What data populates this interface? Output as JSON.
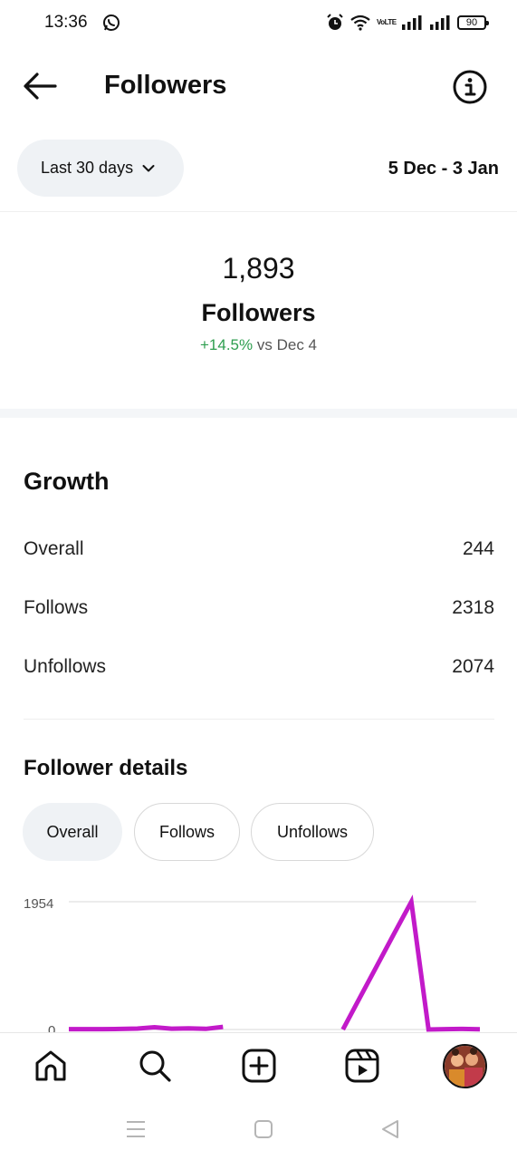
{
  "status_bar": {
    "time": "13:36",
    "volte": "VoLTE",
    "battery": "90"
  },
  "header": {
    "title": "Followers"
  },
  "filter": {
    "range_label": "Last 30 days",
    "date_range": "5 Dec - 3 Jan"
  },
  "summary": {
    "count": "1,893",
    "label": "Followers",
    "change": "+14.5%",
    "change_suffix": " vs Dec 4"
  },
  "growth": {
    "title": "Growth",
    "rows": [
      {
        "label": "Overall",
        "value": "244"
      },
      {
        "label": "Follows",
        "value": "2318"
      },
      {
        "label": "Unfollows",
        "value": "2074"
      }
    ]
  },
  "details": {
    "title": "Follower details",
    "chips": [
      {
        "label": "Overall",
        "active": true
      },
      {
        "label": "Follows",
        "active": false
      },
      {
        "label": "Unfollows",
        "active": false
      }
    ]
  },
  "chart_data": {
    "type": "line",
    "series": [
      {
        "values": [
          5,
          6,
          5,
          8,
          14,
          35,
          12,
          18,
          10,
          40,
          null,
          null,
          null,
          null,
          null,
          null,
          0,
          490,
          980,
          1470,
          1954,
          0,
          5,
          8,
          3
        ]
      }
    ],
    "y_tick_labels": [
      "1954",
      "0"
    ],
    "ylim": [
      0,
      1954
    ],
    "line_color": "#c21ac9",
    "grid": true
  },
  "colors": {
    "positive": "#2e9e4f",
    "chip_active_bg": "#eff2f5",
    "chart_line": "#c21ac9"
  }
}
